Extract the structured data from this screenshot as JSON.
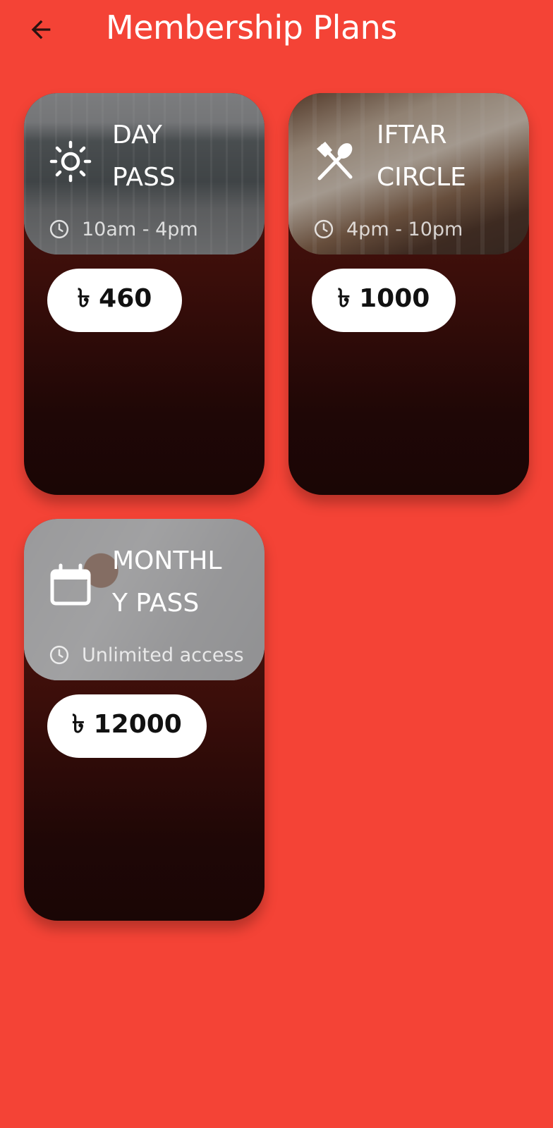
{
  "header": {
    "title": "Membership Plans",
    "back_icon": "arrow-left-icon"
  },
  "colors": {
    "background": "#F44336",
    "price_button": "#FFFFFF",
    "text_primary": "#FFFFFF"
  },
  "plans": [
    {
      "title": "DAY\nPASS",
      "icon": "sun-icon",
      "time": "10am - 4pm",
      "time_icon": "clock-icon",
      "price": "৳ 460"
    },
    {
      "title": "IFTAR\nCIRCLE",
      "icon": "fork-spoon-icon",
      "time": "4pm - 10pm",
      "time_icon": "clock-icon",
      "price": "৳ 1000"
    },
    {
      "title": "MONTHL\nY PASS",
      "icon": "calendar-icon",
      "time": "Unlimited access",
      "time_icon": "clock-icon",
      "price": "৳ 12000"
    }
  ]
}
